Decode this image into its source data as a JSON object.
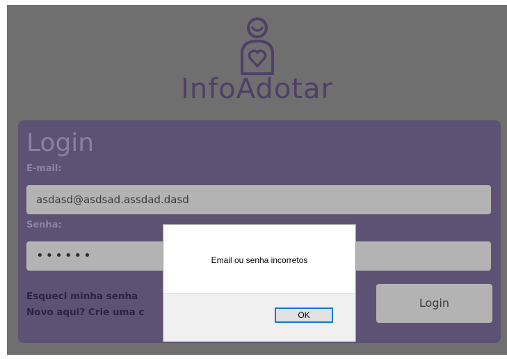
{
  "app": {
    "logo_text": "InfoAdotar"
  },
  "login": {
    "title": "Login",
    "email_label": "E-mail:",
    "email_value": "asdasd@asdsad.assdad.dasd",
    "password_label": "Senha:",
    "password_value": "••••••",
    "forgot_link": "Esqueci minha senha",
    "signup_link": "Novo aqui? Crie uma c",
    "submit_label": "Login"
  },
  "dialog": {
    "message": "Email ou senha incorretos",
    "ok_label": "OK"
  },
  "icons": {
    "logo": "person-heart-icon"
  },
  "colors": {
    "overlay_background": "#6f6f6f",
    "brand": "#4e3f68",
    "card": "#5d5273",
    "dialog_focus": "#0078d7"
  }
}
